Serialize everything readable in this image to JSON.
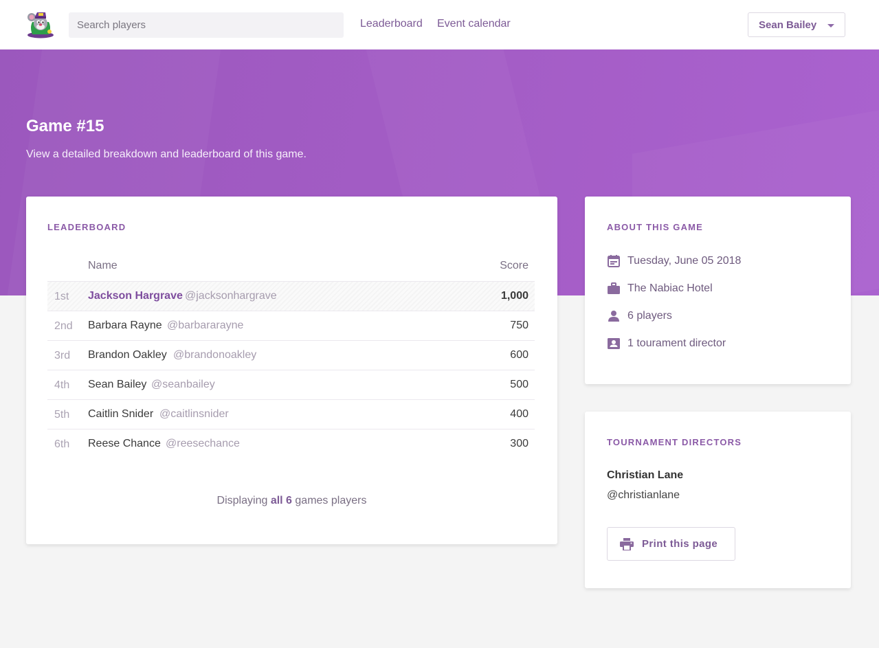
{
  "nav": {
    "logo_icon": "mascot-logo-icon",
    "search_placeholder": "Search players",
    "links": [
      "Leaderboard",
      "Event calendar"
    ],
    "user_name": "Sean Bailey"
  },
  "hero": {
    "title": "Game #15",
    "subtitle": "View a detailed breakdown and leaderboard of this game."
  },
  "leaderboard": {
    "title": "LEADERBOARD",
    "col_name": "Name",
    "col_score": "Score",
    "rows": [
      {
        "rank": "1st",
        "name": "Jackson Hargrave",
        "handle": "@jacksonhargrave",
        "score": "1,000"
      },
      {
        "rank": "2nd",
        "name": "Barbara Rayne",
        "handle": "@barbararayne",
        "score": "750"
      },
      {
        "rank": "3rd",
        "name": "Brandon Oakley",
        "handle": "@brandonoakley",
        "score": "600"
      },
      {
        "rank": "4th",
        "name": "Sean Bailey",
        "handle": "@seanbailey",
        "score": "500"
      },
      {
        "rank": "5th",
        "name": "Caitlin Snider",
        "handle": "@caitlinsnider",
        "score": "400"
      },
      {
        "rank": "6th",
        "name": "Reese Chance",
        "handle": "@reesechance",
        "score": "300"
      }
    ],
    "footer_prefix": "Displaying",
    "footer_bold": "all 6",
    "footer_suffix": "games players"
  },
  "about": {
    "title": "ABOUT THIS GAME",
    "date": "Tuesday, June 05 2018",
    "venue": "The Nabiac Hotel",
    "players": "6 players",
    "directors": "1 tourament director"
  },
  "directors": {
    "title": "TOURNAMENT DIRECTORS",
    "name": "Christian Lane",
    "handle": "@christianlane",
    "print_label": "Print this page"
  },
  "colors": {
    "accent": "#8b5aa7",
    "hero": "#a45dc6",
    "background": "#f4f4f4"
  }
}
